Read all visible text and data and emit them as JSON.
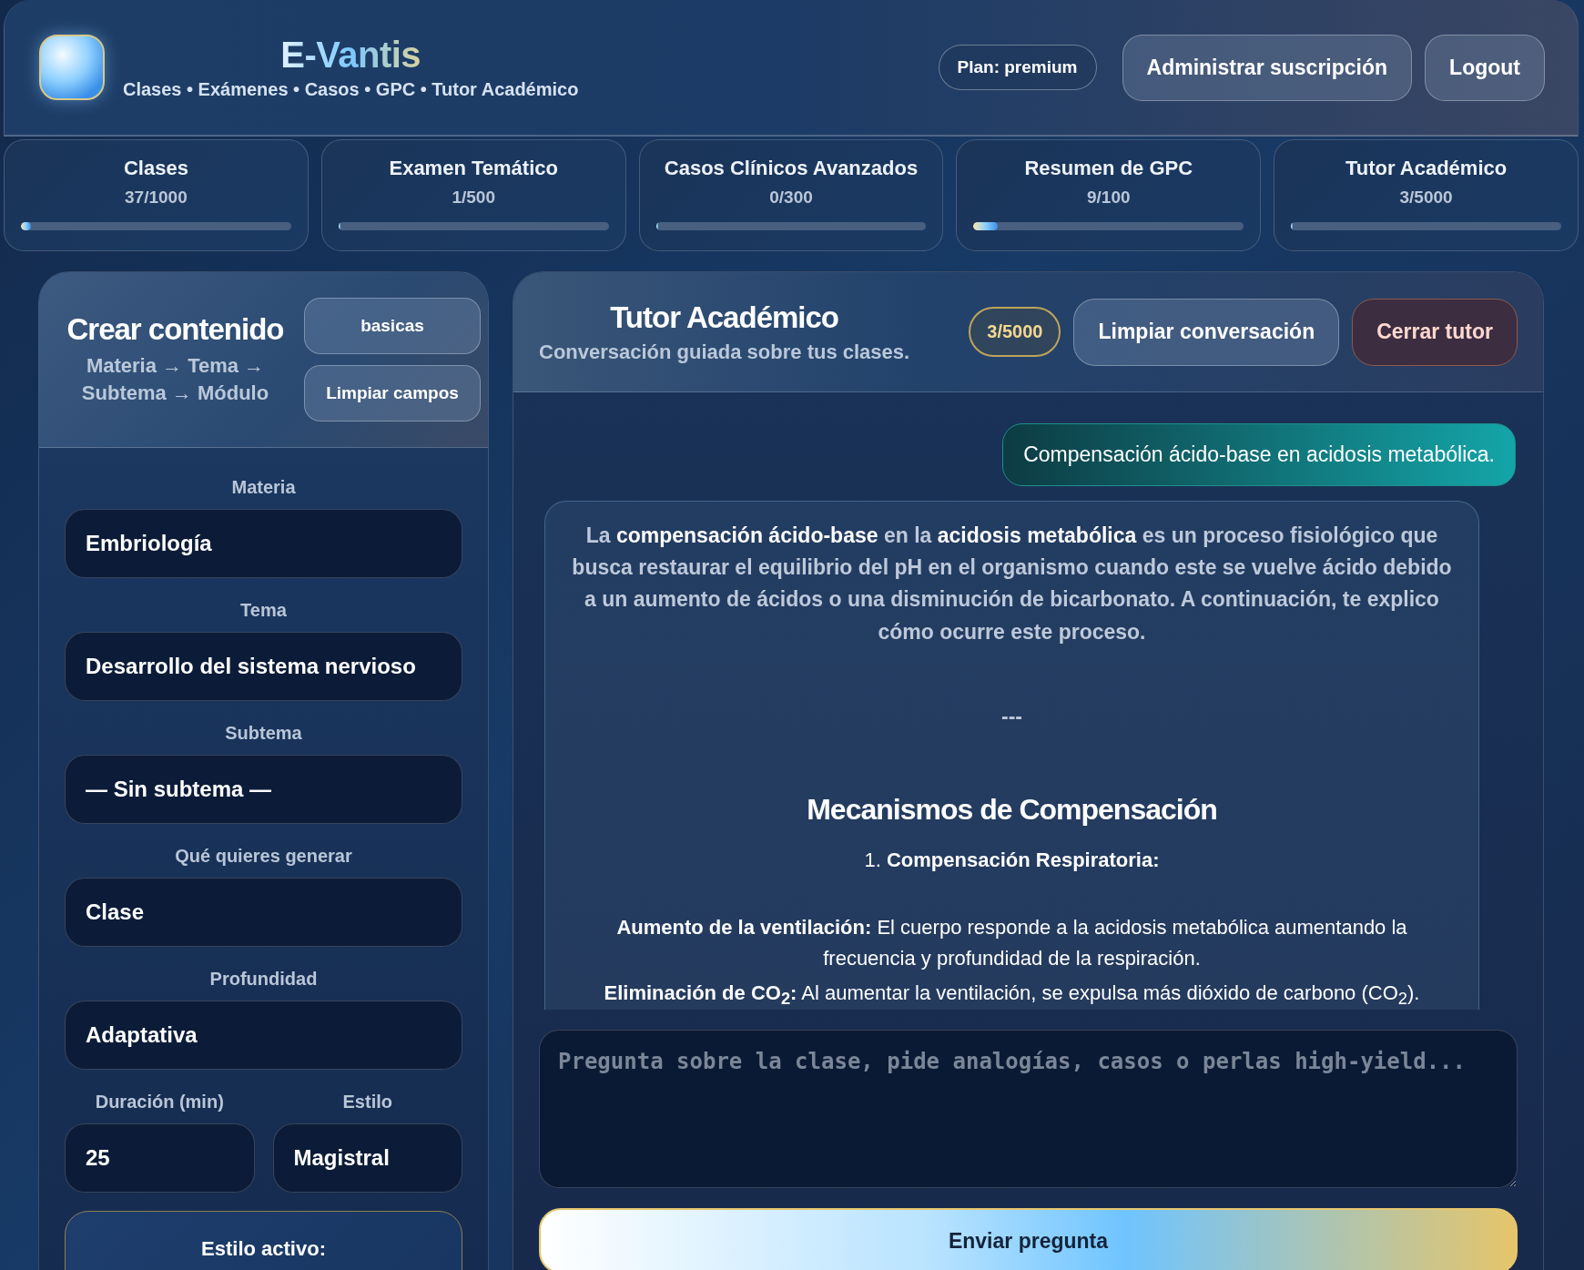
{
  "header": {
    "title": "E-Vantis",
    "subtitle": "Clases • Exámenes • Casos • GPC • Tutor Académico",
    "plan": "Plan: premium",
    "buttons": [
      "Administrar suscripción",
      "Logout"
    ]
  },
  "usage": [
    {
      "label": "Clases",
      "count": "37/1000",
      "level": 0.037
    },
    {
      "label": "Examen Temático",
      "count": "1/500",
      "level": 0.002
    },
    {
      "label": "Casos Clínicos Avanzados",
      "count": "0/300",
      "level": 0
    },
    {
      "label": "Resumen de GPC",
      "count": "9/100",
      "level": 0.09
    },
    {
      "label": "Tutor Académico",
      "count": "3/5000",
      "level": 0.0006
    }
  ],
  "creator": {
    "title": "Crear contenido",
    "path": "Materia → Tema → Subtema → Módulo",
    "buttons": [
      "basicas",
      "Limpiar campos"
    ],
    "fields": [
      {
        "label": "Materia",
        "value": "Embriología"
      },
      {
        "label": "Tema",
        "value": "Desarrollo del sistema nervioso"
      },
      {
        "label": "Subtema",
        "value": "— Sin subtema —"
      },
      {
        "label": "Qué quieres generar",
        "value": "Clase"
      },
      {
        "label": "Profundidad",
        "value": "Adaptativa"
      }
    ],
    "pair_fields": [
      {
        "label": "Duración (min)",
        "value": "25"
      },
      {
        "label": "Estilo",
        "value": "Magistral"
      }
    ],
    "style_card": "Estilo activo:"
  },
  "tutor": {
    "title": "Tutor Académico",
    "subtitle": "Conversación guiada sobre tus clases.",
    "counter": "3/5000",
    "buttons": [
      {
        "label": "Limpiar conversación",
        "kind": "neutral"
      },
      {
        "label": "Cerrar tutor",
        "kind": "danger"
      }
    ],
    "messages": [
      {
        "kind": "user",
        "text": "Compensación ácido-base en acidosis metabólica."
      },
      {
        "kind": "assistant",
        "blocks": [
          {
            "kind": "intro",
            "text": "La **compensación ácido-base** en la **acidosis metabólica** es un proceso fisiológico que busca restaurar el equilibrio del pH en el organismo cuando este se vuelve ácido debido a un aumento de ácidos o una disminución de bicarbonato. A continuación, te explico cómo ocurre este proceso."
          },
          {
            "kind": "separator",
            "text": "---"
          },
          {
            "kind": "heading",
            "text": "Mecanismos de Compensación"
          },
          {
            "kind": "numbered",
            "text": "1. **Compensación Respiratoria:**"
          },
          {
            "kind": "detail",
            "text": "**Aumento de la ventilación:** El cuerpo responde a la acidosis metabólica aumentando la frecuencia y profundidad de la respiración."
          },
          {
            "kind": "detail",
            "text": "**Eliminación de CO$_{2}$:** Al aumentar la ventilación, se expulsa más dióxido de carbono (CO$_{2}$)."
          }
        ]
      }
    ],
    "input": {
      "placeholder": "Pregunta sobre la clase, pide analogías, casos o perlas high-yield..."
    },
    "send": "Enviar pregunta"
  }
}
